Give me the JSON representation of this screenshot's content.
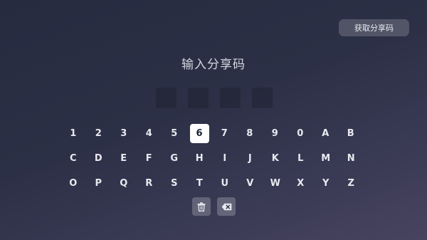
{
  "header": {
    "get_code_label": "获取分享码"
  },
  "main": {
    "title": "输入分享码",
    "code_slots": [
      "",
      "",
      "",
      ""
    ]
  },
  "keyboard": {
    "selected_key": "6",
    "rows": [
      [
        "1",
        "2",
        "3",
        "4",
        "5",
        "6",
        "7",
        "8",
        "9",
        "0",
        "A",
        "B"
      ],
      [
        "C",
        "D",
        "E",
        "F",
        "G",
        "H",
        "I",
        "J",
        "K",
        "L",
        "M",
        "N"
      ],
      [
        "O",
        "P",
        "Q",
        "R",
        "S",
        "T",
        "U",
        "V",
        "W",
        "X",
        "Y",
        "Z"
      ]
    ],
    "actions": {
      "delete_icon": "trash-icon",
      "backspace_icon": "backspace-icon"
    }
  },
  "colors": {
    "selected_key_bg": "#ffffff",
    "selected_key_text": "#1e2233",
    "text": "#e8e9ef"
  }
}
